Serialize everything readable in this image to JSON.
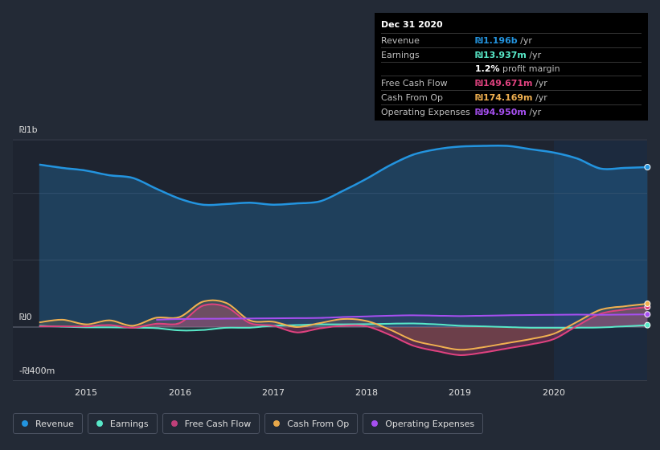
{
  "tooltip": {
    "date": "Dec 31 2020",
    "rows": [
      {
        "label": "Revenue",
        "value": "₪1.196b",
        "unit": " /yr",
        "color": "#2394df"
      },
      {
        "label": "Earnings",
        "value": "₪13.937m",
        "unit": " /yr",
        "color": "#58e8c8"
      },
      {
        "label": "",
        "value": "1.2%",
        "unit": " profit margin",
        "color": "#ffffff"
      },
      {
        "label": "Free Cash Flow",
        "value": "₪149.671m",
        "unit": " /yr",
        "color": "#e0427f"
      },
      {
        "label": "Cash From Op",
        "value": "₪174.169m",
        "unit": " /yr",
        "color": "#f0b050"
      },
      {
        "label": "Operating Expenses",
        "value": "₪94.950m",
        "unit": " /yr",
        "color": "#a64ff0"
      }
    ]
  },
  "legend": [
    {
      "label": "Revenue",
      "color": "#2394df"
    },
    {
      "label": "Earnings",
      "color": "#58e8c8"
    },
    {
      "label": "Free Cash Flow",
      "color": "#c0407a"
    },
    {
      "label": "Cash From Op",
      "color": "#e8a84a"
    },
    {
      "label": "Operating Expenses",
      "color": "#a64ff0"
    }
  ],
  "chart_data": {
    "type": "area",
    "title": "",
    "xlabel": "",
    "ylabel": "",
    "y_tick_labels": [
      "₪1b",
      "₪0",
      "-₪400m"
    ],
    "x_tick_labels": [
      "2015",
      "2016",
      "2017",
      "2018",
      "2019",
      "2020"
    ],
    "ylim": [
      -400,
      1400
    ],
    "xlim": [
      2014.5,
      2021.0
    ],
    "units": "₪ millions",
    "highlight_from": 2020.0,
    "series": [
      {
        "name": "Revenue",
        "color": "#2394df",
        "x": [
          2014.5,
          2014.75,
          2015.0,
          2015.25,
          2015.5,
          2015.75,
          2016.0,
          2016.25,
          2016.5,
          2016.75,
          2017.0,
          2017.25,
          2017.5,
          2017.75,
          2018.0,
          2018.25,
          2018.5,
          2018.75,
          2019.0,
          2019.25,
          2019.5,
          2019.75,
          2020.0,
          2020.25,
          2020.5,
          2020.75,
          2021.0
        ],
        "values": [
          1215,
          1190,
          1170,
          1135,
          1115,
          1035,
          960,
          915,
          920,
          930,
          915,
          925,
          940,
          1020,
          1110,
          1210,
          1290,
          1330,
          1350,
          1355,
          1355,
          1330,
          1305,
          1260,
          1185,
          1190,
          1196
        ]
      },
      {
        "name": "Earnings",
        "color": "#58e8c8",
        "x": [
          2014.5,
          2014.75,
          2015.0,
          2015.25,
          2015.5,
          2015.75,
          2016.0,
          2016.25,
          2016.5,
          2016.75,
          2017.0,
          2017.25,
          2017.5,
          2017.75,
          2018.0,
          2018.25,
          2018.5,
          2018.75,
          2019.0,
          2019.25,
          2019.5,
          2019.75,
          2020.0,
          2020.25,
          2020.5,
          2020.75,
          2021.0
        ],
        "values": [
          10,
          2,
          -2,
          -2,
          -5,
          -8,
          -25,
          -22,
          -5,
          -5,
          10,
          15,
          20,
          20,
          22,
          25,
          27,
          20,
          10,
          5,
          0,
          -5,
          -5,
          -5,
          -3,
          5,
          14
        ]
      },
      {
        "name": "Free Cash Flow",
        "color": "#e0427f",
        "x": [
          2014.5,
          2014.75,
          2015.0,
          2015.25,
          2015.5,
          2015.75,
          2016.0,
          2016.25,
          2016.5,
          2016.75,
          2017.0,
          2017.25,
          2017.5,
          2017.75,
          2018.0,
          2018.25,
          2018.5,
          2018.75,
          2019.0,
          2019.25,
          2019.5,
          2019.75,
          2020.0,
          2020.25,
          2020.5,
          2020.75,
          2021.0
        ],
        "values": [
          5,
          5,
          5,
          15,
          -5,
          25,
          30,
          160,
          150,
          30,
          10,
          -40,
          -10,
          10,
          5,
          -60,
          -140,
          -180,
          -210,
          -190,
          -160,
          -130,
          -90,
          10,
          100,
          130,
          150
        ]
      },
      {
        "name": "Cash From Op",
        "color": "#f0b050",
        "x": [
          2014.5,
          2014.75,
          2015.0,
          2015.25,
          2015.5,
          2015.75,
          2016.0,
          2016.25,
          2016.5,
          2016.75,
          2017.0,
          2017.25,
          2017.5,
          2017.75,
          2018.0,
          2018.25,
          2018.5,
          2018.75,
          2019.0,
          2019.25,
          2019.5,
          2019.75,
          2020.0,
          2020.25,
          2020.5,
          2020.75,
          2021.0
        ],
        "values": [
          35,
          55,
          20,
          50,
          10,
          70,
          75,
          190,
          180,
          50,
          40,
          0,
          30,
          60,
          45,
          -20,
          -100,
          -140,
          -170,
          -150,
          -120,
          -90,
          -50,
          40,
          130,
          155,
          174
        ]
      },
      {
        "name": "Operating Expenses",
        "color": "#a64ff0",
        "x": [
          2014.5,
          2014.75,
          2015.0,
          2015.25,
          2015.5,
          2015.75,
          2016.0,
          2016.25,
          2016.5,
          2016.75,
          2017.0,
          2017.25,
          2017.5,
          2017.75,
          2018.0,
          2018.25,
          2018.5,
          2018.75,
          2019.0,
          2019.25,
          2019.5,
          2019.75,
          2020.0,
          2020.25,
          2020.5,
          2020.75,
          2021.0
        ],
        "values": [
          null,
          null,
          null,
          null,
          null,
          55,
          60,
          62,
          63,
          64,
          65,
          67,
          68,
          75,
          80,
          85,
          88,
          85,
          82,
          85,
          88,
          90,
          92,
          93,
          92,
          93,
          95
        ]
      }
    ]
  }
}
